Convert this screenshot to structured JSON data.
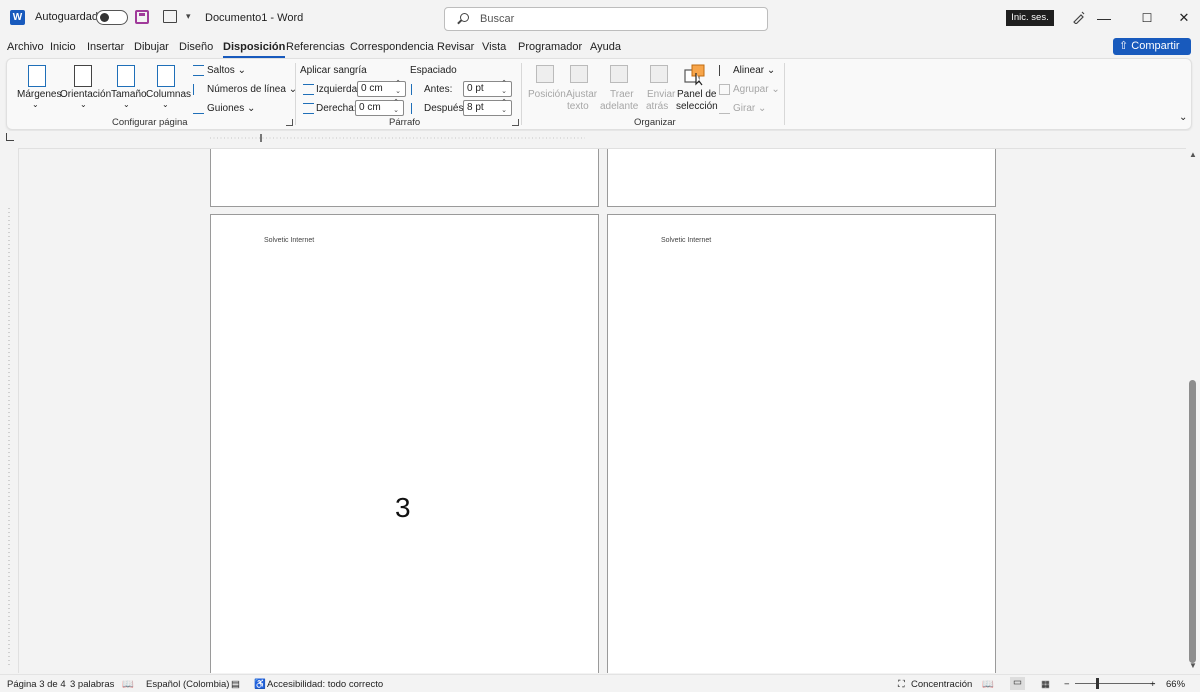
{
  "titlebar": {
    "autosave_label": "Autoguardado",
    "doc_title": "Documento1  -  Word",
    "search_placeholder": "Buscar",
    "signin_label": "Inic. ses.",
    "minimize": "—",
    "maximize": "☐",
    "close": "✕",
    "word_letter": "W"
  },
  "menu": {
    "tabs": [
      "Archivo",
      "Inicio",
      "Insertar",
      "Dibujar",
      "Diseño",
      "Disposición",
      "Referencias",
      "Correspondencia",
      "Revisar",
      "Vista",
      "Programador",
      "Ayuda"
    ],
    "active_tab": "Disposición",
    "share_label": "Compartir"
  },
  "ribbon": {
    "page_setup": {
      "margins": "Márgenes",
      "orientation": "Orientación",
      "size": "Tamaño",
      "columns": "Columnas",
      "breaks": "Saltos",
      "line_numbers": "Números de línea",
      "hyphenation": "Guiones",
      "group_name": "Configurar página"
    },
    "paragraph": {
      "indent_heading": "Aplicar sangría",
      "spacing_heading": "Espaciado",
      "left_label": "Izquierda:",
      "left_value": "0 cm",
      "right_label": "Derecha:",
      "right_value": "0 cm",
      "before_label": "Antes:",
      "before_value": "0 pt",
      "after_label": "Después:",
      "after_value": "8 pt",
      "group_name": "Párrafo"
    },
    "arrange": {
      "position": "Posición",
      "wrap_1": "Ajustar",
      "wrap_2": "texto",
      "forward_1": "Traer",
      "forward_2": "adelante",
      "backward_1": "Enviar",
      "backward_2": "atrás",
      "selection_1": "Panel de",
      "selection_2": "selección",
      "align": "Alinear",
      "group": "Agrupar",
      "rotate": "Girar",
      "group_name": "Organizar"
    }
  },
  "document": {
    "header_text_left": "Solvetic Internet",
    "header_text_right": "Solvetic Internet",
    "page_number": "3"
  },
  "statusbar": {
    "page": "Página 3 de 4",
    "words": "3 palabras",
    "language": "Español (Colombia)",
    "accessibility": "Accesibilidad: todo correcto",
    "focus": "Concentración",
    "zoom": "66%",
    "zoom_minus": "−",
    "zoom_plus": "+"
  },
  "colors": {
    "accent": "#185abd",
    "page_border": "#9a9a9a",
    "background": "#f3f3f3"
  }
}
